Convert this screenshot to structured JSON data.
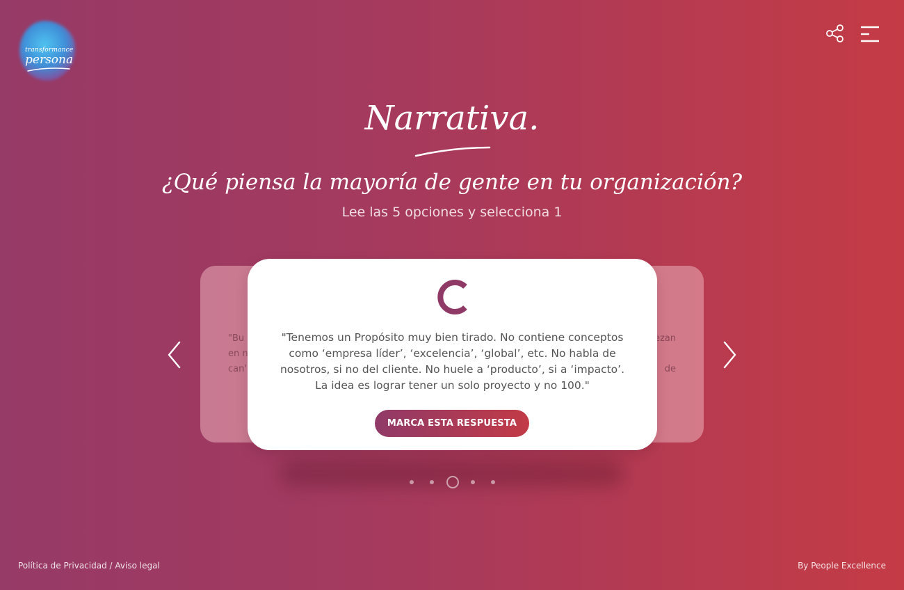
{
  "logo": {
    "line1": "transformance",
    "line2": "persona"
  },
  "header": {
    "share_icon": "share-icon",
    "menu_icon": "menu-icon"
  },
  "main": {
    "title": "Narrativa.",
    "question": "¿Qué piensa la mayoría de gente en tu organización?",
    "instruction": "Lee las 5 opciones y selecciona 1"
  },
  "carousel": {
    "prev_fragment": "\"Bu\nen n\ncan',",
    "next_fragment": "ezan\n\nde",
    "current": {
      "letter": "C",
      "text": "\"Tenemos un Propósito muy bien tirado. No contiene conceptos como ‘empresa líder’, ‘excelencia’, ‘global’, etc. No habla de nosotros, si no del cliente. No huele a ‘producto’, si a ‘impacto’. La idea es lograr tener un solo proyecto y no 100.\"",
      "button_label": "MARCA ESTA RESPUESTA"
    },
    "total": 5,
    "active_index": 2,
    "prev_icon": "chevron-left-icon",
    "next_icon": "chevron-right-icon"
  },
  "footer": {
    "privacy": "Política de Privacidad",
    "separator": " / ",
    "legal": "Aviso legal",
    "credit": "By People Excellence"
  },
  "colors": {
    "gradient_start": "#963a67",
    "gradient_end": "#c43b45",
    "accent": "#8f3a66"
  }
}
